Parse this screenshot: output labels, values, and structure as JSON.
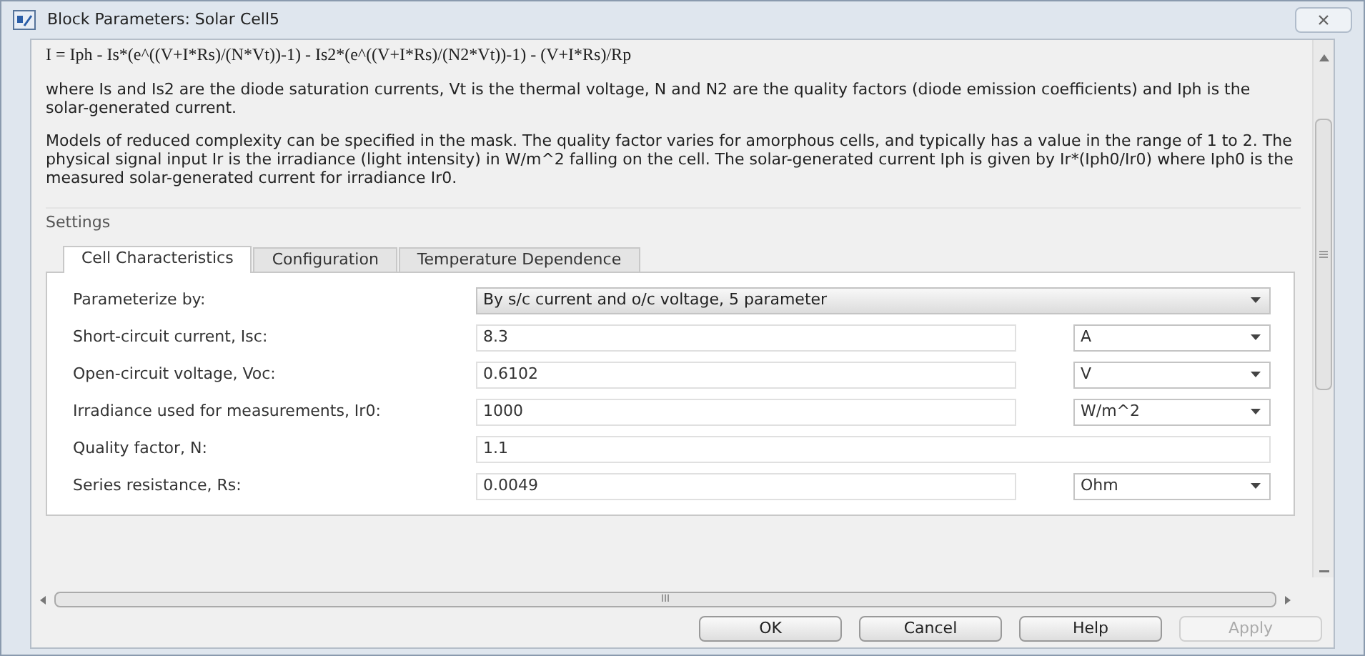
{
  "window": {
    "title": "Block Parameters: Solar Cell5"
  },
  "description": {
    "equation": "I = Iph - Is*(e^((V+I*Rs)/(N*Vt))-1) - Is2*(e^((V+I*Rs)/(N2*Vt))-1) - (V+I*Rs)/Rp",
    "paragraphs": [
      "where Is and Is2 are the diode saturation currents, Vt is the thermal voltage, N and N2 are the quality factors (diode emission coefficients) and Iph is the solar-generated current.",
      "Models of reduced complexity can be specified in the mask. The quality factor varies for amorphous cells, and typically has a value in the range of 1 to 2. The physical signal input Ir is the irradiance (light intensity) in W/m^2 falling on the cell. The solar-generated current Iph is given by Ir*(Iph0/Ir0) where Iph0 is the measured solar-generated current for irradiance Ir0."
    ]
  },
  "settings": {
    "label": "Settings",
    "tabs": [
      {
        "label": "Cell Characteristics",
        "selected": true
      },
      {
        "label": "Configuration",
        "selected": false
      },
      {
        "label": "Temperature Dependence",
        "selected": false
      }
    ],
    "parameters": [
      {
        "kind": "dropdown",
        "label": "Parameterize by:",
        "value": "By s/c current and o/c voltage, 5 parameter"
      },
      {
        "kind": "unit",
        "label": "Short-circuit current, Isc:",
        "value": "8.3",
        "unit": "A"
      },
      {
        "kind": "unit",
        "label": "Open-circuit voltage, Voc:",
        "value": "0.6102",
        "unit": "V"
      },
      {
        "kind": "unit",
        "label": "Irradiance used for measurements, Ir0:",
        "value": "1000",
        "unit": "W/m^2"
      },
      {
        "kind": "plain",
        "label": "Quality factor, N:",
        "value": "1.1"
      },
      {
        "kind": "unit",
        "label": "Series resistance, Rs:",
        "value": "0.0049",
        "unit": "Ohm"
      }
    ]
  },
  "scrollbar": {
    "thumb_label": "III"
  },
  "buttons": [
    {
      "label": "OK",
      "disabled": false
    },
    {
      "label": "Cancel",
      "disabled": false
    },
    {
      "label": "Help",
      "disabled": false
    },
    {
      "label": "Apply",
      "disabled": true
    }
  ]
}
